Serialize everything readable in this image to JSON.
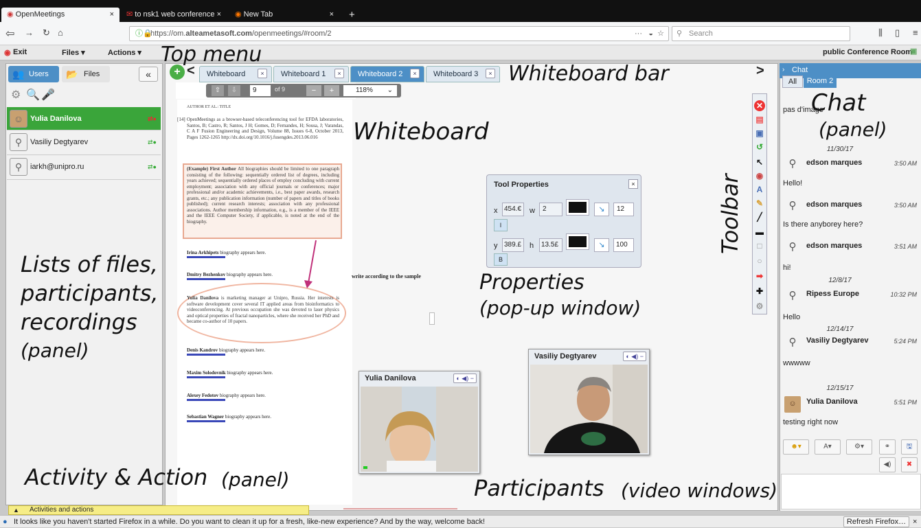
{
  "browser": {
    "tabs": [
      {
        "title": "OpenMeetings",
        "close": "×"
      },
      {
        "title": "to nsk1 web conference",
        "close": "×"
      },
      {
        "title": "New Tab",
        "close": "×"
      }
    ],
    "new_tab": "+",
    "url_prefix": "https://om.",
    "url_domain": "alteametasoft.com",
    "url_path": "/openmeetings/#room/2",
    "url_menu": "···",
    "search_placeholder": "Search"
  },
  "menu": {
    "exit": "Exit",
    "files": "Files",
    "actions": "Actions",
    "room_title": "public Conference Room"
  },
  "left_panel": {
    "tab_users": "Users",
    "tab_files": "Files",
    "collapse": "«",
    "users": [
      {
        "name": "Yulia Danilova",
        "active": true
      },
      {
        "name": "Vasiliy Degtyarev",
        "active": false
      },
      {
        "name": "iarkh@unipro.ru",
        "active": false
      }
    ]
  },
  "whiteboard_bar": {
    "add": "+",
    "prev": "<",
    "next": ">",
    "tabs": [
      {
        "label": "Whiteboard"
      },
      {
        "label": "Whiteboard 1"
      },
      {
        "label": "Whiteboard 2",
        "active": true
      },
      {
        "label": "Whiteboard 3"
      }
    ],
    "close": "×"
  },
  "doc_nav": {
    "page": "9",
    "of": "of 9",
    "zoom": "118%"
  },
  "document": {
    "header": "AUTHOR ET AL.: TITLE",
    "ref_number": "[14]",
    "ref_text": "OpenMeetings as a browser-based teleconferencing tool for EFDA laboratories, Santos, B; Castro, R; Santos, J H; Gomes, D; Fernandes, H; Sousa, J; Varandas, C A F Fusion Engineering and Design, Volume 88, Issues 6-8, October 2013, Pages 1262-1265 http://dx.doi.org/10.1016/j.fusengdes.2013.06.016",
    "example_bold": "(Example) First Author",
    "example_text": "All biographies should be limited to one paragraph consisting of the following: sequentially ordered list of degrees, including years achieved; sequentially ordered places of employ concluding with current employment; association with any official journals or conferences; major professional and/or academic achievements, i.e., best paper awards, research grants, etc.; any publication information (number of papers and titles of books published); current research interests; association with any professional associations. Author membership information, e.g., is a member of the IEEE and the IEEE Computer Society, if applicable, is noted at the end of the biography.",
    "bios": [
      {
        "name": "Irina Arkhipets",
        "text": " biography appears here."
      },
      {
        "name": "Dmitry Bezhenkov",
        "text": " biography appears here."
      }
    ],
    "yulia_bold": "Yulia Danilova",
    "yulia_text": "is marketing manager at Unipro, Russia. Her interests is software development cover several IT applied areas from bioinformatics to videoconferencing. At previous occupation she was devoted to laser physics and optical properties of fractal nanoparticles, where she received her PhD and became co-author of 10 papers.",
    "bios2": [
      {
        "name": "Denis Kandrov",
        "text": " biography appears here."
      },
      {
        "name": "Maxim Solodovnik",
        "text": " biography appears here."
      },
      {
        "name": "Alexey Fedotov",
        "text": " biography appears here."
      },
      {
        "name": "Sebastian Wagner",
        "text": " biography appears here."
      }
    ],
    "handwriting": "write according to the sample"
  },
  "tool_properties": {
    "title": "Tool Properties",
    "close": "×",
    "x_label": "x",
    "x_value": "454.€",
    "w_label": "w",
    "w_value": "2",
    "line_size": "12",
    "italic": "I",
    "y_label": "y",
    "y_value": "389.£",
    "h_label": "h",
    "h_value": "13.5£",
    "opacity": "100",
    "bold": "B"
  },
  "videos": [
    {
      "name": "Yulia Danilova"
    },
    {
      "name": "Vasiliy Degtyarev"
    }
  ],
  "video_controls": "◐ ◀) −",
  "chat": {
    "header": "Chat",
    "tabs": [
      {
        "label": "All"
      },
      {
        "label": "Room 2",
        "active": true
      }
    ],
    "first_text": "pas d'image",
    "messages": [
      {
        "date": "11/30/17",
        "user": "edson marques",
        "time": "3:50 AM",
        "text": "Hello!"
      },
      {
        "user": "edson marques",
        "time": "3:50 AM",
        "text": "Is there anyborey here?"
      },
      {
        "user": "edson marques",
        "time": "3:51 AM",
        "text": "hi!"
      },
      {
        "date": "12/8/17",
        "user": "Ripess Europe",
        "time": "10:32 PM",
        "text": "Hello"
      },
      {
        "date": "12/14/17",
        "user": "Vasiliy Degtyarev",
        "time": "5:24 PM",
        "text": "wwwww"
      },
      {
        "date": "12/15/17",
        "user": "Yulia Danilova",
        "time": "5:51 PM",
        "text": "testing right now"
      }
    ],
    "buttons": {
      "emoji": "☻▾",
      "font": "A▾",
      "settings": "⚙▾",
      "link": "⚭",
      "save": "🖫",
      "sound": "◀)",
      "clear": "✖"
    }
  },
  "activity_bar": "Activities and actions",
  "notification": {
    "text": "It looks like you haven't started Firefox in a while. Do you want to clean it up for a fresh, like-new experience? And by the way, welcome back!",
    "button": "Refresh Firefox…",
    "close": "×"
  },
  "annotations": {
    "top_menu": "Top menu",
    "whiteboard_bar": "Whiteboard bar",
    "whiteboard": "Whiteboard",
    "chat": "Chat",
    "chat_panel": "(panel)",
    "toolbar": "Toolbar",
    "properties": "Properties",
    "popup": "(pop-up window)",
    "lists1": "Lists of files,",
    "lists2": "participants,",
    "lists3": "recordings",
    "lists4": "(panel)",
    "activity": "Activity & Action",
    "activity_panel": "(panel)",
    "participants": "Participants",
    "participants_sub": "(video windows)"
  },
  "colors": {
    "accent_blue": "#4d8fc6",
    "user_green": "#3aa53a",
    "annotation_arrow": "#c0307a"
  }
}
